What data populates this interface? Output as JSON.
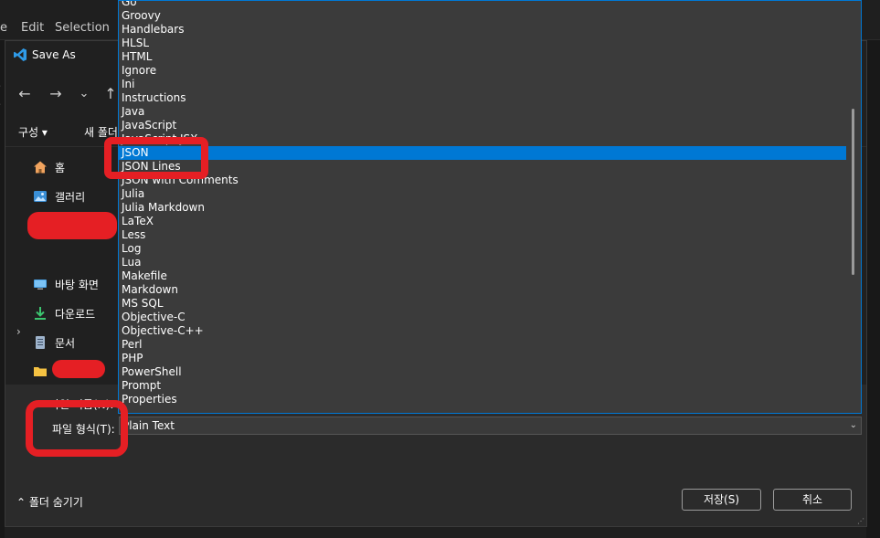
{
  "vscode": {
    "menu": [
      "e",
      "Edit",
      "Selection"
    ]
  },
  "dialog": {
    "title": "Save As",
    "nav": {
      "back": "←",
      "forward": "→",
      "recent": "⌄",
      "up": "↑"
    },
    "toolbar": {
      "organize": "구성 ▾",
      "new_folder": "새 폴더"
    },
    "sidebar": {
      "items": [
        {
          "label": "홈",
          "icon": "home-icon"
        },
        {
          "label": "갤러리",
          "icon": "gallery-icon"
        },
        {
          "label": "",
          "icon": "expander-chevron-icon"
        },
        {
          "label": "바탕 화면",
          "icon": "desktop-icon"
        },
        {
          "label": "다운로드",
          "icon": "download-icon"
        },
        {
          "label": "문서",
          "icon": "document-icon"
        },
        {
          "label": "",
          "icon": "folder-icon"
        }
      ]
    },
    "filename_label": "파일 이름(N):",
    "filetype_label": "파일 형식(T):",
    "filetype_value": "Plain Text",
    "hide_folders": "폴더 숨기기",
    "save_label": "저장(S)",
    "cancel_label": "취소"
  },
  "dropdown": {
    "selected": "JSON",
    "items": [
      "Go",
      "Groovy",
      "Handlebars",
      "HLSL",
      "HTML",
      "Ignore",
      "Ini",
      "Instructions",
      "Java",
      "JavaScript",
      "JavaScript JSX",
      "JSON",
      "JSON Lines",
      "JSON with Comments",
      "Julia",
      "Julia Markdown",
      "LaTeX",
      "Less",
      "Log",
      "Lua",
      "Makefile",
      "Markdown",
      "MS SQL",
      "Objective-C",
      "Objective-C++",
      "Perl",
      "PHP",
      "PowerShell",
      "Prompt",
      "Properties"
    ]
  },
  "colors": {
    "accent": "#0078d4",
    "annotation_red": "#e51f24",
    "dialog_bg": "#202020",
    "dropdown_bg": "#3b3b3b"
  }
}
